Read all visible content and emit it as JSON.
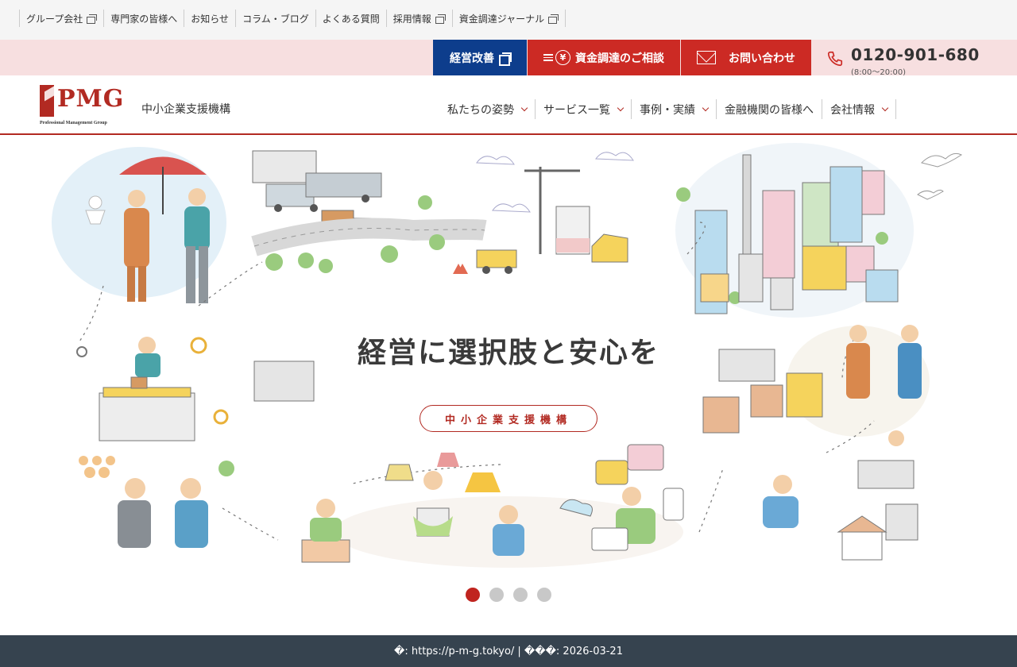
{
  "utility_nav": {
    "items": [
      {
        "label": "グループ会社",
        "external": true
      },
      {
        "label": "専門家の皆様へ",
        "external": false
      },
      {
        "label": "お知らせ",
        "external": false
      },
      {
        "label": "コラム・ブログ",
        "external": false
      },
      {
        "label": "よくある質問",
        "external": false
      },
      {
        "label": "採用情報",
        "external": true
      },
      {
        "label": "資金調達ジャーナル",
        "external": true
      }
    ]
  },
  "cta": {
    "kaizen_label": "経営改善",
    "shikin_label": "資金調達のご相談",
    "contact_label": "お問い合わせ",
    "phone_number": "0120-901-680",
    "phone_hours": "(8:00〜20:00)",
    "colors": {
      "navy": "#0d3d8c",
      "red": "#cc2a24",
      "pink_bg": "#f7dfe0"
    }
  },
  "header": {
    "logo_text": "PMG",
    "logo_subtitle": "Professional Management Group",
    "org_name": "中小企業支援機構",
    "nav": [
      {
        "label": "私たちの姿勢",
        "dropdown": true
      },
      {
        "label": "サービス一覧",
        "dropdown": true
      },
      {
        "label": "事例・実績",
        "dropdown": true
      },
      {
        "label": "金融機関の皆様へ",
        "dropdown": false
      },
      {
        "label": "会社情報",
        "dropdown": true
      }
    ],
    "accent_color": "#b22a22"
  },
  "hero": {
    "title": "経営に選択肢と安心を",
    "badge": "中小企業支援機構",
    "slides_total": 4,
    "active_slide": 1
  },
  "footer": {
    "info": "�: https://p-m-g.tokyo/ | ���: 2026-03-21"
  }
}
